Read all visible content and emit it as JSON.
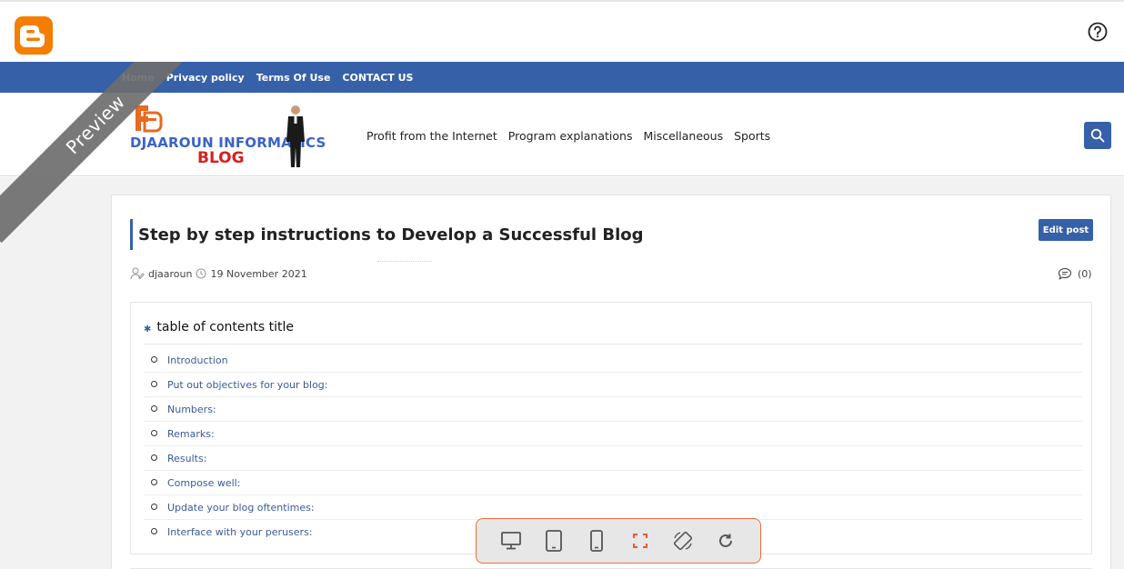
{
  "nav": {
    "links": [
      "Home",
      "Privacy policy",
      "Terms Of Use",
      "CONTACT US"
    ]
  },
  "header": {
    "logo_line1": "DJAAROUN INFORMATICS",
    "logo_line2": "BLOG",
    "menu": [
      "Profit from the Internet",
      "Program explanations",
      "Miscellaneous",
      "Sports"
    ]
  },
  "post": {
    "title": "Step by step instructions to Develop a Successful Blog",
    "edit_label": "Edit post",
    "author": "djaaroun",
    "date": "19 November 2021",
    "comments": "(0)"
  },
  "toc": {
    "title": "table of contents title",
    "items": [
      "Introduction",
      "Put out objectives for your blog:",
      "Numbers:",
      "Remarks:",
      "Results:",
      "Compose well:",
      "Update your blog oftentimes:",
      "Interface with your perusers:"
    ]
  },
  "ribbon": {
    "label": "Preview"
  },
  "colors": {
    "brand_blue": "#3660a8",
    "blogger_orange": "#f57d00",
    "toolbar_border": "#ef6d3a"
  },
  "device_toolbar": {
    "icons": [
      "desktop-icon",
      "tablet-icon",
      "mobile-icon",
      "fullscreen-icon",
      "rotate-icon",
      "refresh-icon"
    ]
  }
}
